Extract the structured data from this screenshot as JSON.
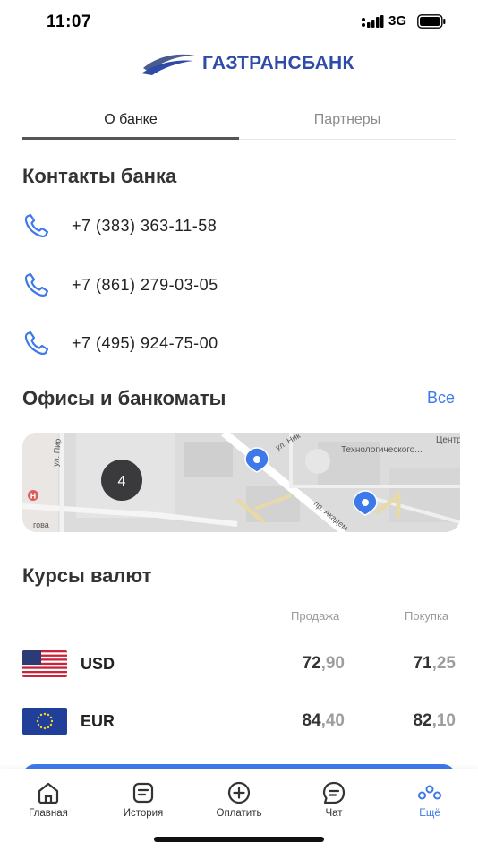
{
  "status_bar": {
    "time": "11:07",
    "network": "3G"
  },
  "header": {
    "logo_text": "ГАЗТРАНСБАНК"
  },
  "tabs": [
    {
      "label": "О банке",
      "active": true
    },
    {
      "label": "Партнеры",
      "active": false
    }
  ],
  "contacts": {
    "title": "Контакты банка",
    "phones": [
      "+7 (383) 363-11-58",
      "+7 (861) 279-03-05",
      "+7 (495) 924-75-00"
    ]
  },
  "offices": {
    "title": "Офисы и банкоматы",
    "all_link": "Все",
    "map": {
      "cluster_count": "4",
      "street_labels": [
        "ул. Пир",
        "ул. Ник",
        "пр. Академ",
        "Центр",
        "Технологического...",
        "гова"
      ]
    }
  },
  "rates": {
    "title": "Курсы валют",
    "col_sell": "Продажа",
    "col_buy": "Покупка",
    "rows": [
      {
        "code": "USD",
        "sell_int": "72",
        "sell_frac": ",90",
        "buy_int": "71",
        "buy_frac": ",25"
      },
      {
        "code": "EUR",
        "sell_int": "84",
        "sell_frac": ",40",
        "buy_int": "82",
        "buy_frac": ",10"
      }
    ]
  },
  "nav": [
    {
      "label": "Главная",
      "icon": "home-icon"
    },
    {
      "label": "История",
      "icon": "history-icon"
    },
    {
      "label": "Оплатить",
      "icon": "pay-icon"
    },
    {
      "label": "Чат",
      "icon": "chat-icon"
    },
    {
      "label": "Ещё",
      "icon": "more-icon",
      "active": true
    }
  ],
  "colors": {
    "accent": "#3d79e8",
    "brand": "#2f4ba8"
  }
}
